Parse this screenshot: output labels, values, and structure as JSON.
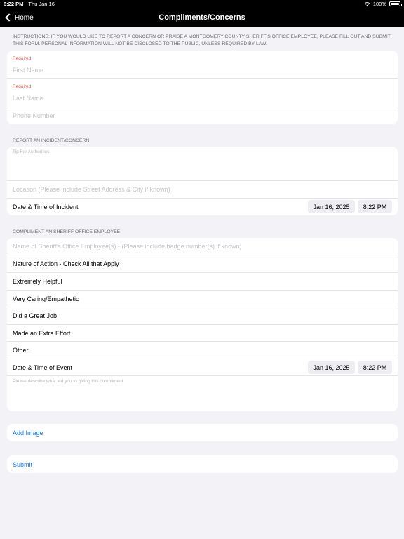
{
  "status": {
    "time": "8:22 PM",
    "date": "Thu Jan 16",
    "battery": "100%"
  },
  "nav": {
    "back": "Home",
    "title": "Compliments/Concerns"
  },
  "instructions": "INSTRUCTIONS: IF YOU WOULD LIKE TO REPORT A CONCERN OR PRAISE A MONTGOMERY COUNTY SHERIFF'S OFFICE EMPLOYEE, PLEASE FILL OUT AND SUBMIT THIS FORM. PERSONAL INFORMATION WILL NOT BE DISCLOSED TO THE PUBLIC, UNLESS REQUIRED BY LAW.",
  "personal": {
    "required_label": "Required",
    "first_name_ph": "First Name",
    "last_name_ph": "Last Name",
    "phone_ph": "Phone Number"
  },
  "incident": {
    "header": "REPORT AN INCIDENT/CONCERN",
    "tip_ph": "Tip For Authorities",
    "location_ph": "Location (Please include Street Address & City if known)",
    "datetime_label": "Date & Time of Incident",
    "date": "Jan 16, 2025",
    "time": "8:22 PM"
  },
  "compliment": {
    "header": "COMPLIMENT AN SHERIFF OFFICE EMPLOYEE",
    "employee_ph": "Name of Sheriff's Office Employee(s) - (Please include badge number(s) if known)",
    "nature_label": "Nature of Action - Check All that Apply",
    "options": [
      "Extremely Helpful",
      "Very Caring/Empathetic",
      "Did a Great Job",
      "Made an Extra Effort",
      "Other"
    ],
    "datetime_label": "Date & Time of Event",
    "date": "Jan 16, 2025",
    "time": "8:22 PM",
    "describe_ph": "Please describe what led you to giving this compliment"
  },
  "actions": {
    "add_image": "Add Image",
    "submit": "Submit"
  }
}
